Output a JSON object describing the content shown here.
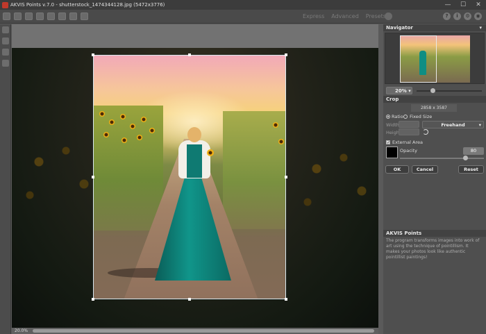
{
  "window": {
    "title": "AKVIS Points v.7.0 - shutterstock_1474344128.jpg (5472x3776)",
    "min_glyph": "—",
    "max_glyph": "☐",
    "close_glyph": "✕"
  },
  "toolbar": {
    "modes": [
      "Express",
      "Advanced",
      "Presets"
    ],
    "right_icons": [
      "?",
      "i",
      "⚙",
      "◉"
    ]
  },
  "status": {
    "zoom": "20.0%"
  },
  "navigator": {
    "title": "Navigator",
    "collapse_glyph": "▾",
    "zoom_value": "20%",
    "zoom_arrow": "▾"
  },
  "crop": {
    "title": "Crop",
    "size": "2858 x 3587",
    "ratio_label": "Ratio",
    "fixed_size_label": "Fixed Size",
    "width_label": "Width",
    "height_label": "Height",
    "preset_value": "Freehand",
    "preset_arrow": "▾",
    "external_area_label": "External Area",
    "external_area_checked": true,
    "check_glyph": "✓",
    "external_color": "#000000",
    "opacity_label": "Opacity",
    "opacity_value": "80",
    "ok_label": "OK",
    "cancel_label": "Cancel",
    "reset_label": "Reset"
  },
  "info": {
    "title": "AKVIS Points",
    "text": "The program transforms images into work of art using the technique of pointillism. It makes your photos look like authentic pointillist paintings!"
  },
  "colors": {
    "accent_red": "#c0392b",
    "dress_teal": "#10958a"
  }
}
